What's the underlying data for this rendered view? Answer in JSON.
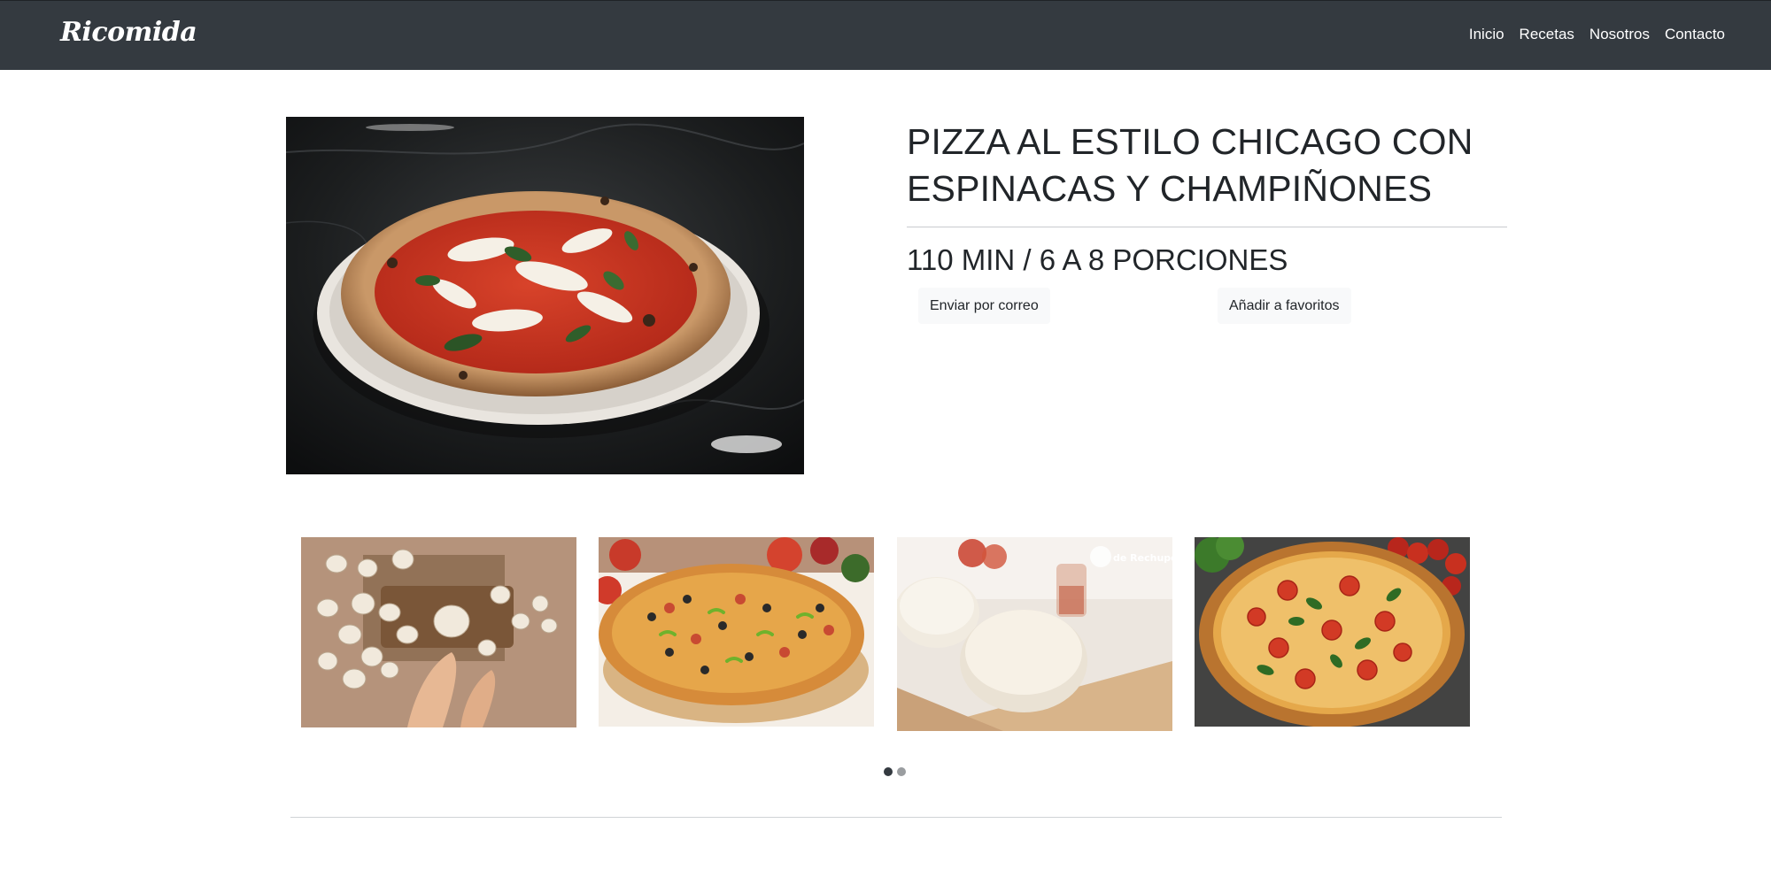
{
  "navbar": {
    "brand": "Ricomida",
    "links": [
      "Inicio",
      "Recetas",
      "Nosotros",
      "Contacto"
    ]
  },
  "recipe": {
    "title_line1": "PIZZA AL ESTILO CHICAGO CON",
    "title_line2": "ESPINACAS Y CHAMPIÑONES",
    "meta": "110 MIN / 6 A 8 PORCIONES",
    "email_button": "Enviar por correo",
    "favorite_button": "Añadir a favoritos"
  },
  "carousel": {
    "watermark": "de Rechupete",
    "active_slide": 1,
    "slide_count": 2
  },
  "colors": {
    "navbar_bg": "#343a40",
    "button_bg": "#f8f9fa",
    "text": "#212529"
  }
}
